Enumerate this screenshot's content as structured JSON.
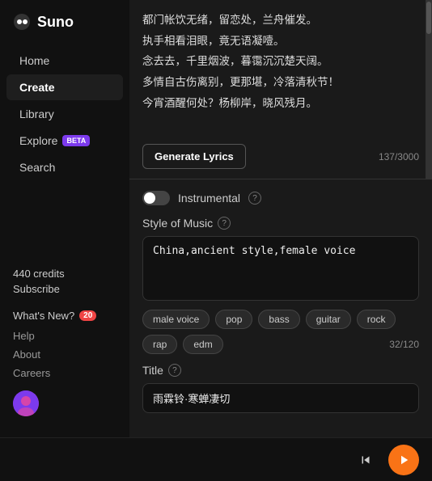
{
  "logo": {
    "text": "Suno"
  },
  "sidebar": {
    "nav": [
      {
        "id": "home",
        "label": "Home",
        "active": false
      },
      {
        "id": "create",
        "label": "Create",
        "active": true
      },
      {
        "id": "library",
        "label": "Library",
        "active": false
      },
      {
        "id": "explore",
        "label": "Explore",
        "active": false,
        "badge": "BETA"
      },
      {
        "id": "search",
        "label": "Search",
        "active": false
      }
    ],
    "credits": "440 credits",
    "subscribe": "Subscribe",
    "whatsNew": "What's New?",
    "notificationCount": "20",
    "links": [
      "Help",
      "About",
      "Careers"
    ]
  },
  "lyrics": {
    "lines": [
      "都门帐饮无绪，留恋处，兰舟催发。",
      "执手相看泪眼，竟无语凝噎。",
      "念去去，千里烟波，暮霭沉沉楚天阔。",
      "多情自古伤离别，更那堪，冷落清秋节！",
      "今宵酒醒何处？杨柳岸，晓风残月。"
    ],
    "generateBtn": "Generate Lyrics",
    "charCount": "137/3000"
  },
  "instrumental": {
    "label": "Instrumental",
    "enabled": false
  },
  "styleOfMusic": {
    "label": "Style of Music",
    "value": "China,ancient style,female voice",
    "charCount": "32/120",
    "tags": [
      {
        "id": "male-voice",
        "label": "male voice"
      },
      {
        "id": "pop",
        "label": "pop"
      },
      {
        "id": "bass",
        "label": "bass"
      },
      {
        "id": "guitar",
        "label": "guitar"
      },
      {
        "id": "rock",
        "label": "rock"
      },
      {
        "id": "rap",
        "label": "rap"
      },
      {
        "id": "edm",
        "label": "edm"
      }
    ]
  },
  "title": {
    "label": "Title",
    "value": "雨霖铃·寒蝉凄切"
  },
  "player": {
    "skipBackIcon": "⏮",
    "playIcon": "▶"
  }
}
